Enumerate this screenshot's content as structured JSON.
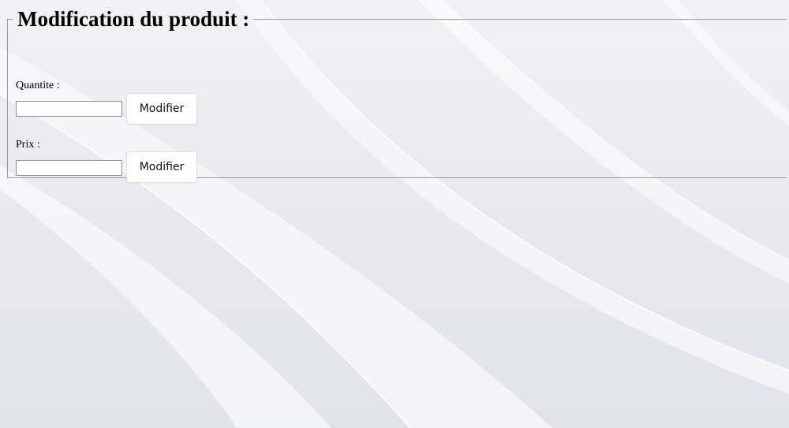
{
  "form": {
    "legend": "Modification du produit :",
    "quantity": {
      "label": "Quantite :",
      "value": "",
      "button_label": "Modifier"
    },
    "price": {
      "label": "Prix :",
      "value": "",
      "button_label": "Modifier"
    }
  },
  "colors": {
    "background": "#e9e9ee",
    "fieldset_border": "#9a9a9a",
    "button_background": "#ffffff"
  }
}
